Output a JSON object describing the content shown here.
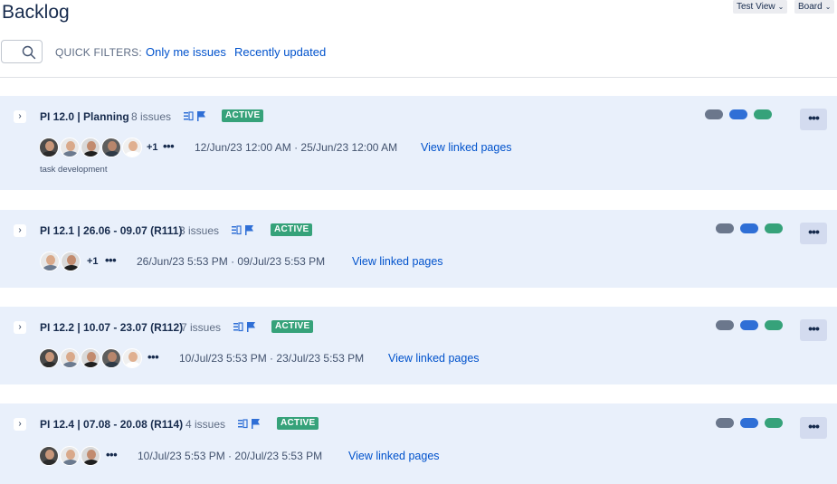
{
  "header": {
    "title": "Backlog",
    "test_view_label": "Test View",
    "board_label": "Board"
  },
  "filters": {
    "quick_filters_label": "QUICK FILTERS:",
    "only_me": "Only me issues",
    "recently_updated": "Recently updated"
  },
  "colors": {
    "pill_gray": "#6b778c",
    "pill_blue": "#2f6fd6",
    "pill_green": "#36a27a",
    "badge_green": "#36a27a",
    "sprint_bg": "#e9f0fb",
    "link_blue": "#0052cc"
  },
  "sprints": [
    {
      "title": "PI 12.0 | Planning",
      "count": "8 issues",
      "status": "ACTIVE",
      "extra_members": "+1",
      "dates": "12/Jun/23 12:00 AM  ·  25/Jun/23 12:00 AM",
      "linked": "View linked pages",
      "description": "task development"
    },
    {
      "title": "PI 12.1 | 26.06 - 09.07 (R111)",
      "count": "3 issues",
      "status": "ACTIVE",
      "extra_members": "+1",
      "dates": "26/Jun/23 5:53 PM  ·  09/Jul/23 5:53 PM",
      "linked": "View linked pages"
    },
    {
      "title": "PI 12.2 | 10.07 - 23.07 (R112)",
      "count": "7 issues",
      "status": "ACTIVE",
      "dates": "10/Jul/23 5:53 PM  ·  23/Jul/23 5:53 PM",
      "linked": "View linked pages"
    },
    {
      "title": "PI 12.4 | 07.08 - 20.08 (R114)",
      "count": "4 issues",
      "status": "ACTIVE",
      "dates": "10/Jul/23 5:53 PM  ·  20/Jul/23 5:53 PM",
      "linked": "View linked pages"
    }
  ],
  "icons": {
    "search": "search-icon",
    "list": "list-icon",
    "flag": "flag-icon",
    "expand": "chevron-right-icon",
    "more": "more-icon"
  }
}
